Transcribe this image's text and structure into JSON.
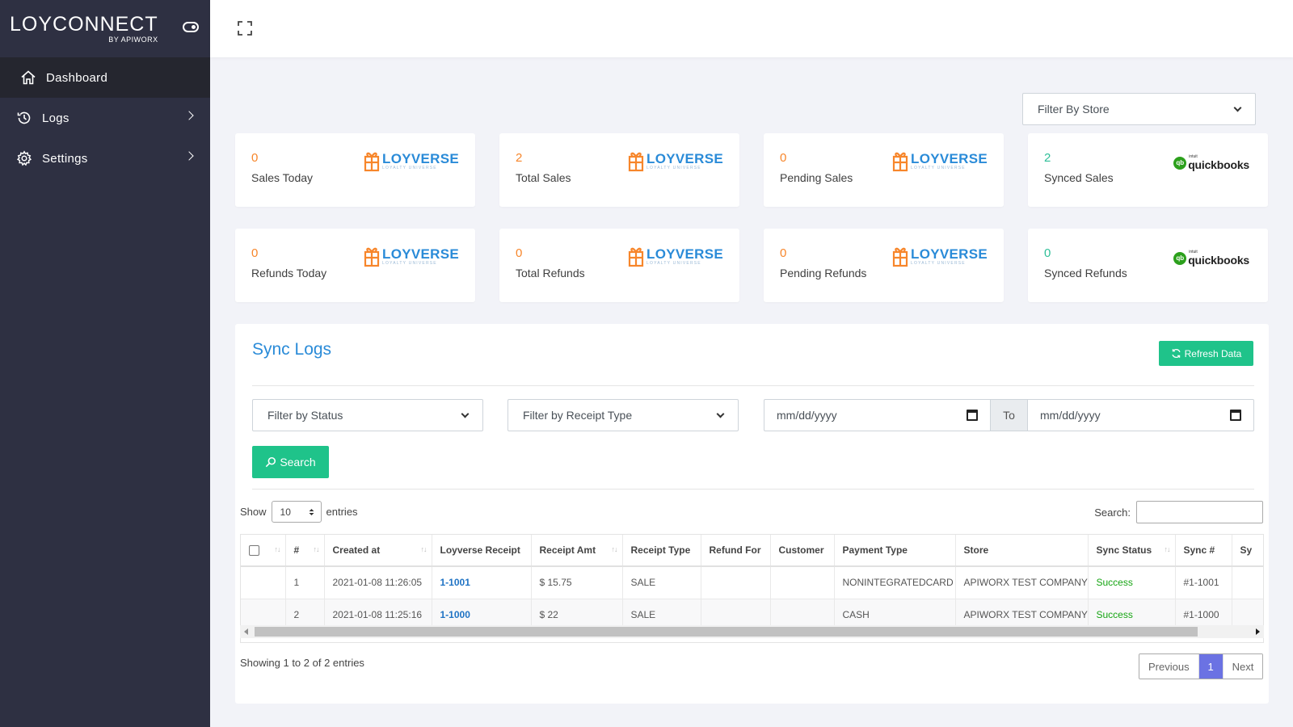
{
  "brand": {
    "name": "LOYCONNECT",
    "sub": "BY APIWORX"
  },
  "sidebar": {
    "items": [
      {
        "label": "Dashboard"
      },
      {
        "label": "Logs"
      },
      {
        "label": "Settings"
      }
    ]
  },
  "store_filter": {
    "placeholder": "Filter By Store"
  },
  "stats": [
    {
      "value": "0",
      "label": "Sales Today",
      "source": "LOYVERSE",
      "source_sub": "LOYALTY UNIVERSE",
      "color": "#f7862b"
    },
    {
      "value": "2",
      "label": "Total Sales",
      "source": "LOYVERSE",
      "source_sub": "LOYALTY UNIVERSE",
      "color": "#f7862b"
    },
    {
      "value": "0",
      "label": "Pending Sales",
      "source": "LOYVERSE",
      "source_sub": "LOYALTY UNIVERSE",
      "color": "#f7862b"
    },
    {
      "value": "2",
      "label": "Synced Sales",
      "source": "quickbooks",
      "source_sub": "intuit",
      "color": "#2fbf98"
    },
    {
      "value": "0",
      "label": "Refunds Today",
      "source": "LOYVERSE",
      "source_sub": "LOYALTY UNIVERSE",
      "color": "#f7862b"
    },
    {
      "value": "0",
      "label": "Total Refunds",
      "source": "LOYVERSE",
      "source_sub": "LOYALTY UNIVERSE",
      "color": "#f7862b"
    },
    {
      "value": "0",
      "label": "Pending Refunds",
      "source": "LOYVERSE",
      "source_sub": "LOYALTY UNIVERSE",
      "color": "#f7862b"
    },
    {
      "value": "0",
      "label": "Synced Refunds",
      "source": "quickbooks",
      "source_sub": "intuit",
      "color": "#2fbf98"
    }
  ],
  "sync": {
    "title": "Sync Logs",
    "refresh_label": "Refresh Data",
    "status_filter": "Filter by Status",
    "receipt_filter": "Filter by Receipt Type",
    "date_from": "mm/dd/yyyy",
    "date_to_label": "To",
    "date_to": "mm/dd/yyyy",
    "search_label": "Search",
    "show_label": "Show",
    "entries_value": "10",
    "entries_label": "entries",
    "search_box_label": "Search:",
    "columns": [
      "",
      "#",
      "Created at",
      "Loyverse Receipt",
      "Receipt Amt",
      "Receipt Type",
      "Refund For",
      "Customer",
      "Payment Type",
      "Store",
      "Sync Status",
      "Sync #",
      "Sy"
    ],
    "rows": [
      {
        "num": "1",
        "created": "2021-01-08 11:26:05",
        "receipt": "1-1001",
        "amt": "$ 15.75",
        "type": "SALE",
        "refund_for": "",
        "customer": "",
        "payment": "NONINTEGRATEDCARD",
        "store": "APIWORX TEST COMPANY",
        "status": "Success",
        "sync_num": "#1-1001"
      },
      {
        "num": "2",
        "created": "2021-01-08 11:25:16",
        "receipt": "1-1000",
        "amt": "$ 22",
        "type": "SALE",
        "refund_for": "",
        "customer": "",
        "payment": "CASH",
        "store": "APIWORX TEST COMPANY",
        "status": "Success",
        "sync_num": "#1-1000"
      }
    ],
    "info": "Showing 1 to 2 of 2 entries",
    "pager": {
      "prev": "Previous",
      "current": "1",
      "next": "Next"
    }
  }
}
